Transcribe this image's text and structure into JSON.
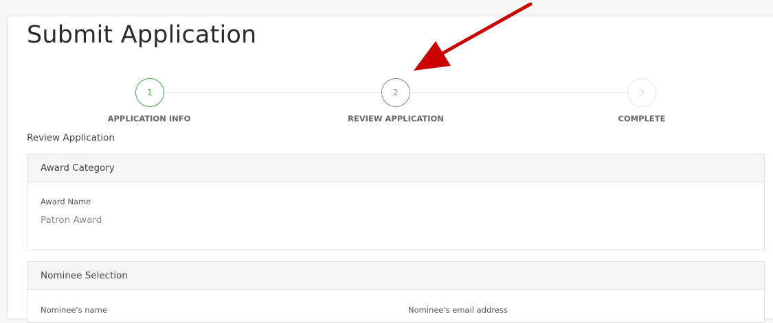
{
  "page": {
    "title": "Submit Application"
  },
  "stepper": {
    "steps": [
      {
        "number": "1",
        "label": "APPLICATION INFO",
        "state": "completed"
      },
      {
        "number": "2",
        "label": "REVIEW APPLICATION",
        "state": "active"
      },
      {
        "number": "3",
        "label": "COMPLETE",
        "state": "pending"
      }
    ]
  },
  "review": {
    "heading": "Review Application",
    "award_category": {
      "header": "Award Category",
      "award_name_label": "Award Name",
      "award_name_value": "Patron Award"
    },
    "nominee_selection": {
      "header": "Nominee Selection",
      "name_label": "Nominee's name",
      "email_label": "Nominee's email address"
    }
  },
  "colors": {
    "completed_step": "#3ea84a",
    "active_step": "#8a8a8a",
    "annotation_arrow": "#cc0000"
  },
  "icons": {
    "annotation": "red-arrow-icon"
  }
}
